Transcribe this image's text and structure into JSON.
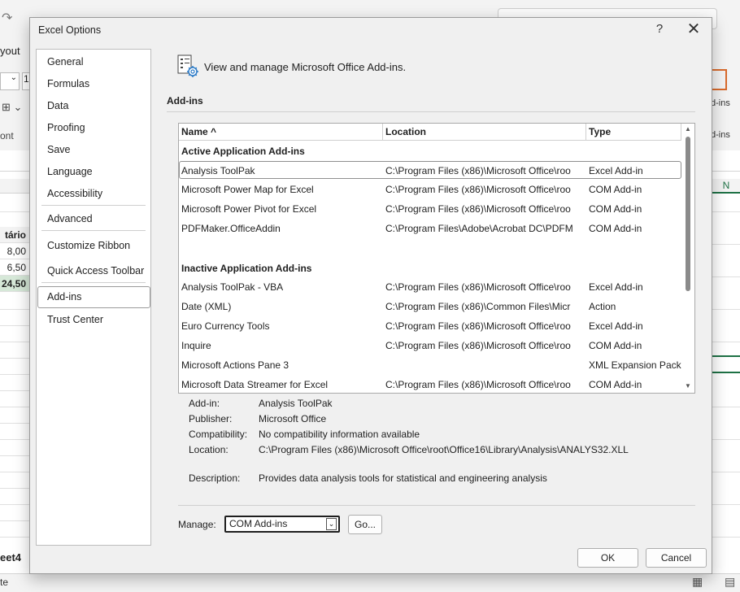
{
  "background": {
    "ribbon_text": "yout",
    "font_size": "",
    "font_size_2": "1",
    "font_group": "ont",
    "addins_label": "d-ins",
    "addins_label2": "d-ins",
    "column_n": "N",
    "rows": [
      "tário",
      "8,00",
      "6,50",
      "24,50"
    ],
    "sheet_tab": "eet4",
    "status_left": "te"
  },
  "dialog": {
    "title": "Excel Options",
    "help": "?",
    "close": "✕"
  },
  "nav": {
    "items": [
      {
        "label": "General"
      },
      {
        "label": "Formulas"
      },
      {
        "label": "Data"
      },
      {
        "label": "Proofing"
      },
      {
        "label": "Save"
      },
      {
        "label": "Language"
      },
      {
        "label": "Accessibility"
      },
      {
        "label": "Advanced"
      },
      {
        "label": "Customize Ribbon"
      },
      {
        "label": "Quick Access Toolbar"
      },
      {
        "label": "Add-ins"
      },
      {
        "label": "Trust Center"
      }
    ],
    "selected": "Add-ins"
  },
  "header": {
    "text": "View and manage Microsoft Office Add-ins."
  },
  "section": {
    "label": "Add-ins"
  },
  "table": {
    "columns": [
      "Name ^",
      "Location",
      "Type"
    ],
    "groups": [
      {
        "title": "Active Application Add-ins",
        "rows": [
          {
            "name": "Analysis ToolPak",
            "location": "C:\\Program Files (x86)\\Microsoft Office\\roo",
            "type": "Excel Add-in"
          },
          {
            "name": "Microsoft Power Map for Excel",
            "location": "C:\\Program Files (x86)\\Microsoft Office\\roo",
            "type": "COM Add-in"
          },
          {
            "name": "Microsoft Power Pivot for Excel",
            "location": "C:\\Program Files (x86)\\Microsoft Office\\roo",
            "type": "COM Add-in"
          },
          {
            "name": "PDFMaker.OfficeAddin",
            "location": "C:\\Program Files\\Adobe\\Acrobat DC\\PDFM",
            "type": "COM Add-in"
          }
        ]
      },
      {
        "title": "Inactive Application Add-ins",
        "rows": [
          {
            "name": "Analysis ToolPak - VBA",
            "location": "C:\\Program Files (x86)\\Microsoft Office\\roo",
            "type": "Excel Add-in"
          },
          {
            "name": "Date (XML)",
            "location": "C:\\Program Files (x86)\\Common Files\\Micr",
            "type": "Action"
          },
          {
            "name": "Euro Currency Tools",
            "location": "C:\\Program Files (x86)\\Microsoft Office\\roo",
            "type": "Excel Add-in"
          },
          {
            "name": "Inquire",
            "location": "C:\\Program Files (x86)\\Microsoft Office\\roo",
            "type": "COM Add-in"
          },
          {
            "name": "Microsoft Actions Pane 3",
            "location": "",
            "type": "XML Expansion Pack"
          },
          {
            "name": "Microsoft Data Streamer for Excel",
            "location": "C:\\Program Files (x86)\\Microsoft Office\\roo",
            "type": "COM Add-in"
          }
        ]
      }
    ]
  },
  "details": {
    "addin_label": "Add-in:",
    "addin_value": "Analysis ToolPak",
    "publisher_label": "Publisher:",
    "publisher_value": "Microsoft Office",
    "compat_label": "Compatibility:",
    "compat_value": "No compatibility information available",
    "location_label": "Location:",
    "location_value": "C:\\Program Files (x86)\\Microsoft Office\\root\\Office16\\Library\\Analysis\\ANALYS32.XLL",
    "desc_label": "Description:",
    "desc_value": "Provides data analysis tools for statistical and engineering analysis"
  },
  "manage": {
    "label": "Manage:",
    "value": "COM Add-ins",
    "go": "Go..."
  },
  "footer": {
    "ok": "OK",
    "cancel": "Cancel"
  }
}
